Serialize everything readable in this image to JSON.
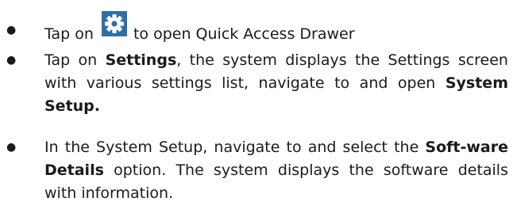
{
  "steps": [
    {
      "before": "Tap on",
      "icon": "gear-icon",
      "after": "to open Quick Access Drawer"
    },
    {
      "before": "Tap on ",
      "bold1": "Settings",
      "middle": ", the system displays the Settings screen with various settings list, navigate to and open ",
      "bold2": "System Setup."
    },
    {
      "before": "In the System Setup, navigate to and select the ",
      "bold1": "Soft-ware Details",
      "after": " option. The system displays the software details with information."
    }
  ],
  "bullet": "●",
  "colors": {
    "icon_background": "#2f6fa9",
    "icon_foreground": "#ffffff"
  }
}
